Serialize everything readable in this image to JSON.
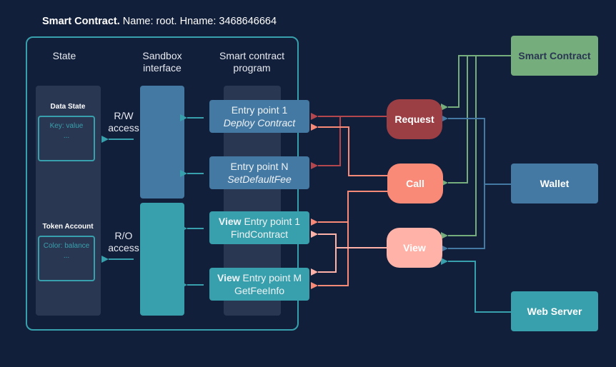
{
  "title": {
    "bold": "Smart Contract.",
    "rest": " Name: root. Hname: 3468646664"
  },
  "columns": {
    "state": "State",
    "sandbox": [
      "Sandbox",
      "interface"
    ],
    "program": [
      "Smart contract",
      "program"
    ]
  },
  "state": {
    "data_state": {
      "title": "Data State",
      "line1": "Key: value",
      "line2": "..."
    },
    "token_account": {
      "title": "Token Account",
      "line1": "Color: balance",
      "line2": "..."
    }
  },
  "access": {
    "rw": [
      "R/W",
      "access"
    ],
    "ro": [
      "R/O",
      "access"
    ]
  },
  "entry_points": [
    {
      "prefix": "",
      "label": "Entry point 1",
      "name": "Deploy Contract",
      "italic": true,
      "color": "#4479a3"
    },
    {
      "prefix": "",
      "label": "Entry point N",
      "name": "SetDefaultFee",
      "italic": true,
      "color": "#4479a3"
    },
    {
      "prefix": "View",
      "label": " Entry point 1",
      "name": "FindContract",
      "italic": false,
      "color": "#38a0ac"
    },
    {
      "prefix": "View",
      "label": " Entry point M",
      "name": "GetFeeInfo",
      "italic": false,
      "color": "#38a0ac"
    }
  ],
  "requests": [
    {
      "label": "Request",
      "color": "#9b3f45"
    },
    {
      "label": "Call",
      "color": "#fa8a78"
    },
    {
      "label": "View",
      "color": "#ffb3a8"
    }
  ],
  "sources": [
    {
      "label": "Smart Contract",
      "color": "#76ad7c",
      "text_color": "#2a3753"
    },
    {
      "label": "Wallet",
      "color": "#4479a3",
      "text_color": "#ffffff"
    },
    {
      "label": "Web Server",
      "color": "#38a0ac",
      "text_color": "#ffffff"
    }
  ],
  "colors": {
    "background": "#121f3a",
    "teal": "#38a0ac",
    "column_bg": "#2a3753",
    "request_line": "#b3474d",
    "call_line": "#fa8a78",
    "view_line": "#ffb3a8",
    "smart_contract_line": "#76ad7c",
    "wallet_line": "#4479a3",
    "webserver_line": "#38a0ac"
  }
}
